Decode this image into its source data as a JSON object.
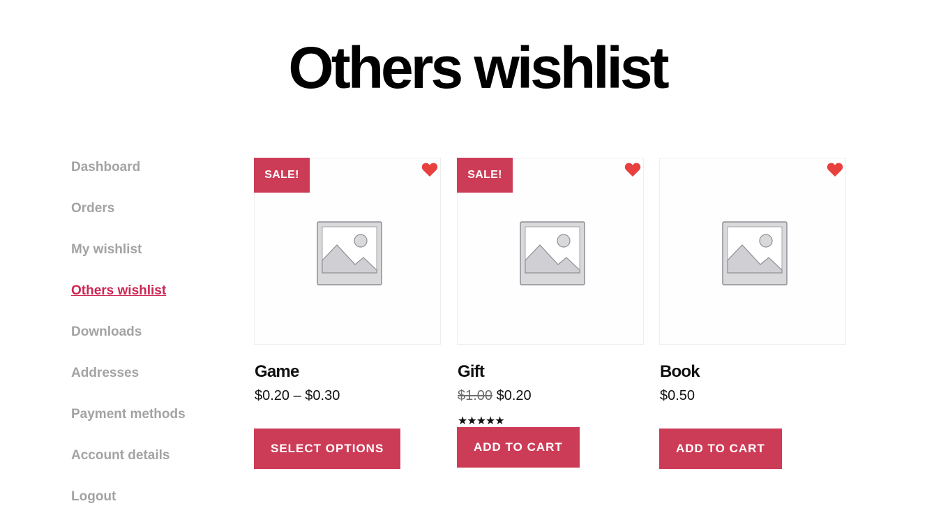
{
  "page": {
    "title": "Others wishlist"
  },
  "nav": {
    "items": [
      {
        "label": "Dashboard",
        "active": false
      },
      {
        "label": "Orders",
        "active": false
      },
      {
        "label": "My wishlist",
        "active": false
      },
      {
        "label": "Others wishlist",
        "active": true
      },
      {
        "label": "Downloads",
        "active": false
      },
      {
        "label": "Addresses",
        "active": false
      },
      {
        "label": "Payment methods",
        "active": false
      },
      {
        "label": "Account details",
        "active": false
      },
      {
        "label": "Logout",
        "active": false
      }
    ]
  },
  "products": [
    {
      "name": "Game",
      "badge": "SALE!",
      "price": "$0.20 – $0.30",
      "button": "SELECT OPTIONS",
      "icon": "heart-icon"
    },
    {
      "name": "Gift",
      "badge": "SALE!",
      "price_old": "$1.00",
      "price_new": "$0.20",
      "rating": 5,
      "rating_stars": "★★★★★",
      "button": "ADD TO CART",
      "icon": "heart-icon"
    },
    {
      "name": "Book",
      "price": "$0.50",
      "button": "ADD TO CART",
      "icon": "heart-icon"
    }
  ],
  "colors": {
    "accent": "#cd2653",
    "button": "#cd3c57",
    "heart": "#e8403f",
    "nav_text": "#a3a3a3"
  }
}
